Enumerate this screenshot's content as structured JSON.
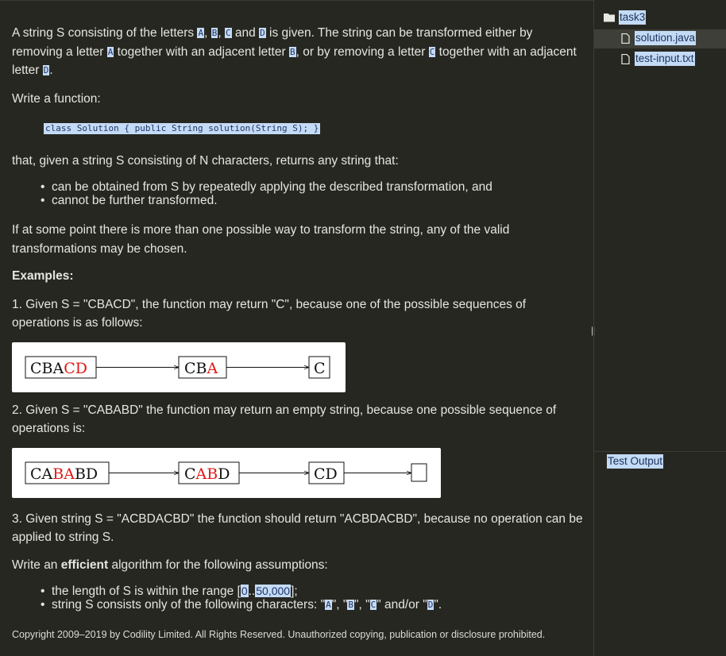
{
  "task": {
    "intro": {
      "t1": "A string S consisting of the letters ",
      "lA": "A",
      "c1": ", ",
      "lB": "B",
      "c2": ", ",
      "lC": "C",
      "and": " and ",
      "lD": "D",
      "t2": " is given. The string can be transformed either by removing a letter ",
      "rA": "A",
      "t3": " together with an adjacent letter ",
      "rB": "B",
      "t4": ", or by removing a letter ",
      "rC": "C",
      "t5": " together with an adjacent letter ",
      "rD": "D",
      "t6": "."
    },
    "write_function": "Write a function:",
    "signature": "class Solution { public String solution(String S); }",
    "that_given": "that, given a string S consisting of N characters, returns any string that:",
    "conditions": [
      "can be obtained from S by repeatedly applying the described transformation, and",
      "cannot be further transformed."
    ],
    "multiple_ways": "If at some point there is more than one possible way to transform the string, any of the valid transformations may be chosen.",
    "examples_heading": "Examples:",
    "example1": "1. Given S = \"CBACD\", the function may return \"C\", because one of the possible sequences of operations is as follows:",
    "figure1": {
      "box1_black": "CBA",
      "box1_red": "CD",
      "box2_black": "CB",
      "box2_red": "A",
      "box3": "C"
    },
    "example2": "2. Given S = \"CABABD\" the function may return an empty string, because one possible sequence of operations is:",
    "figure2": {
      "box1_a": "CA",
      "box1_red": "BA",
      "box1_b": "BD",
      "box2_a": "C",
      "box2_red": "AB",
      "box2_b": "D",
      "box3_red": "CD",
      "box4": ""
    },
    "example3": "3. Given string S = \"ACBDACBD\" the function should return \"ACBDACBD\", because no operation can be applied to string S.",
    "efficient": {
      "pre": "Write an ",
      "bold": "efficient",
      "post": " algorithm for the following assumptions:"
    },
    "assumptions": {
      "a1_pre": "the length of S is within the range [",
      "a1_lo": "0",
      "a1_sep": "..",
      "a1_hi": "50,000",
      "a1_post": "];",
      "a2_pre": "string S consists only of the following characters: \"",
      "a2_A": "A",
      "a2_s1": "\", \"",
      "a2_B": "B",
      "a2_s2": "\", \"",
      "a2_C": "C",
      "a2_s3": "\" and/or \"",
      "a2_D": "D",
      "a2_post": "\"."
    },
    "copyright": "Copyright 2009–2019 by Codility Limited. All Rights Reserved. Unauthorized copying, publication or disclosure prohibited."
  },
  "sidebar": {
    "folder": "task3",
    "files": [
      "solution.java",
      "test-input.txt"
    ],
    "test_output": "Test Output"
  },
  "splitter": "||",
  "colors": {
    "background": "#272722",
    "highlight": "#c4dbf5",
    "selected_row": "#3f3f3a",
    "figure_red": "#e01818"
  }
}
